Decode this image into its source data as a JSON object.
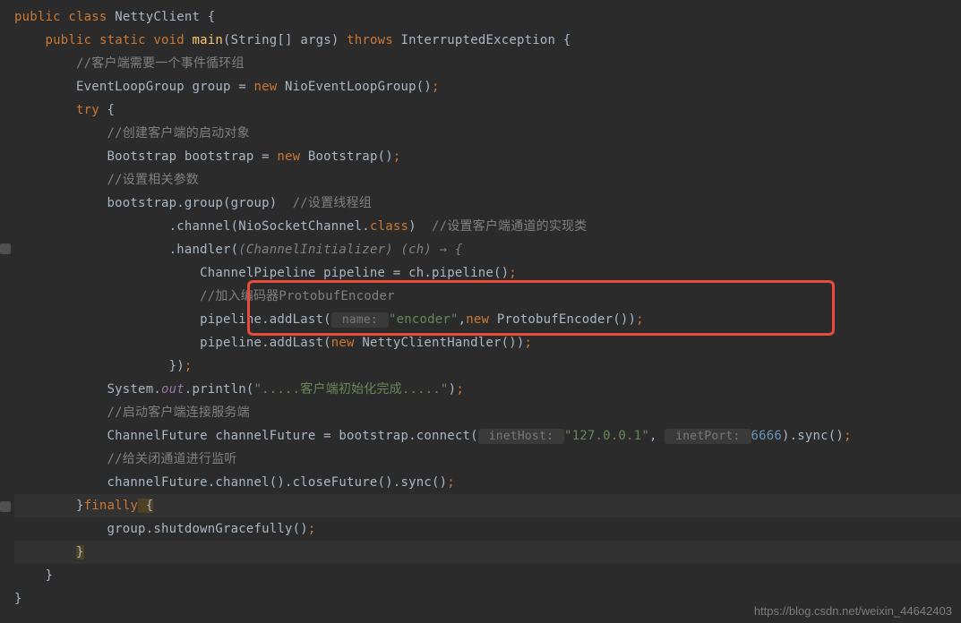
{
  "code": {
    "l1_kw1": "public",
    "l1_kw2": "class",
    "l1_name": "NettyClient",
    "l1_brace": " {",
    "l2_kw1": "public",
    "l2_kw2": "static",
    "l2_kw3": "void",
    "l2_fn": "main",
    "l2_params": "(String[] args)",
    "l2_kw4": "throws",
    "l2_exc": "InterruptedException",
    "l2_brace": " {",
    "l3": "//客户端需要一个事件循环组",
    "l4_a": "EventLoopGroup group = ",
    "l4_new": "new",
    "l4_b": " NioEventLoopGroup()",
    "l4_semi": ";",
    "l5_try": "try",
    "l5_brace": " {",
    "l6": "//创建客户端的启动对象",
    "l7_a": "Bootstrap bootstrap = ",
    "l7_new": "new",
    "l7_b": " Bootstrap()",
    "l7_semi": ";",
    "l8": "//设置相关参数",
    "l9_a": "bootstrap.group(group)  ",
    "l9_c": "//设置线程组",
    "l10_a": ".channel(NioSocketChannel.",
    "l10_cls": "class",
    "l10_b": ")  ",
    "l10_c": "//设置客户端通道的实现类",
    "l11_a": ".handler(",
    "l11_hint": "(ChannelInitializer) (ch) → {",
    "l11_b": "",
    "l12_a": "ChannelPipeline pipeline = ch.pipeline()",
    "l12_semi": ";",
    "l13": "//加入编码器ProtobufEncoder",
    "l14_a": "pipeline.addLast(",
    "l14_hint": " name: ",
    "l14_str": "\"encoder\"",
    "l14_b": ",",
    "l14_new": "new",
    "l14_c": " ProtobufEncoder())",
    "l14_semi": ";",
    "l15_a": "pipeline.addLast(",
    "l15_new": "new",
    "l15_b": " NettyClientHandler())",
    "l15_semi": ";",
    "l16_a": "})",
    "l16_semi": ";",
    "l17_a": "System.",
    "l17_out": "out",
    "l17_b": ".println(",
    "l17_str": "\".....客户端初始化完成.....\"",
    "l17_c": ")",
    "l17_semi": ";",
    "l18": "//启动客户端连接服务端",
    "l19_a": "ChannelFuture channelFuture = bootstrap.connect(",
    "l19_h1": " inetHost: ",
    "l19_s1": "\"127.0.0.1\"",
    "l19_b": ", ",
    "l19_h2": " inetPort: ",
    "l19_n": "6666",
    "l19_c": ").sync()",
    "l19_semi": ";",
    "l20": "//给关闭通道进行监听",
    "l21_a": "channelFuture.channel().closeFuture().sync()",
    "l21_semi": ";",
    "l22_b1": "}",
    "l22_fin": "finally",
    "l22_b2": " {",
    "l23_a": "group.shutdownGracefully()",
    "l23_semi": ";",
    "l24": "}",
    "l25": "}",
    "l26": "}"
  },
  "watermark": "https://blog.csdn.net/weixin_44642403"
}
